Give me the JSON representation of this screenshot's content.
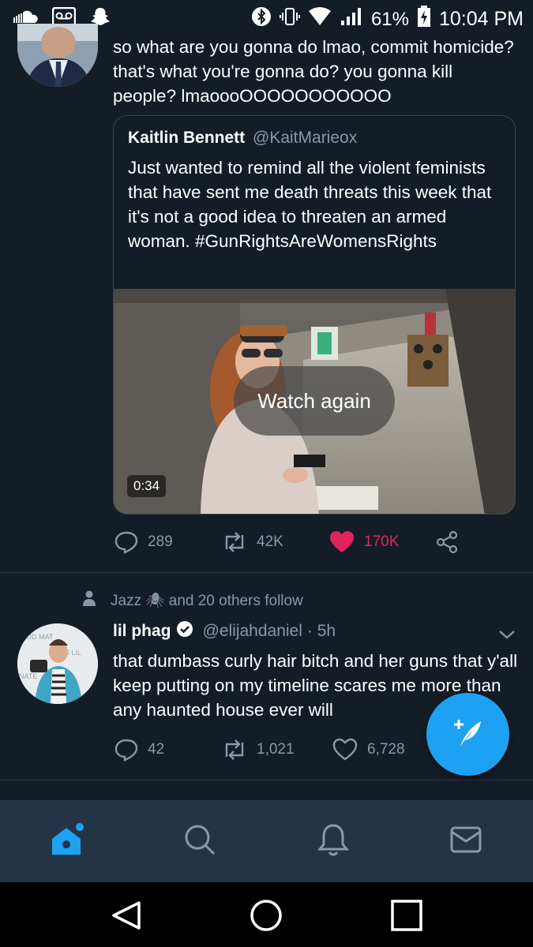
{
  "status_bar": {
    "battery": "61%",
    "time": "10:04 PM",
    "left_icons": [
      "soundcloud-icon",
      "voicemail-icon",
      "snapchat-icon"
    ],
    "right_icons": [
      "bluetooth-icon",
      "vibrate-icon",
      "wifi-icon",
      "signal-icon",
      "battery-charging-icon"
    ]
  },
  "tweet1": {
    "text": "so what are you gonna do lmao, commit homicide? that's what you're gonna do? you gonna kill people? lmaoooOOOOOOOOOOO",
    "quote": {
      "name": "Kaitlin Bennett",
      "handle": "@KaitMarieox",
      "text": "Just wanted to remind all the violent feminists that have sent me death threats this week that it's not a good idea to threaten an armed woman. #GunRightsAreWomensRights",
      "video": {
        "overlay": "Watch again",
        "duration": "0:34"
      }
    },
    "actions": {
      "replies": "289",
      "retweets": "42K",
      "likes": "170K"
    },
    "liked": true
  },
  "tweet2": {
    "social_context": "Jazz 🕷 and 20 others follow",
    "name": "lil phag",
    "handle": "@elijahdaniel",
    "time": "· 5h",
    "text": "that dumbass curly hair bitch and her guns that y'all keep putting on my timeline scares me more than any haunted house ever will",
    "actions": {
      "replies": "42",
      "retweets": "1,021",
      "likes": "6,728"
    }
  },
  "nav": [
    "home-icon",
    "search-icon",
    "notifications-icon",
    "messages-icon"
  ],
  "system_nav": [
    "back-button",
    "home-button",
    "recents-button"
  ],
  "colors": {
    "background": "#141d26",
    "accent": "#1da1f2",
    "like": "#e0245e",
    "muted": "#8899a6",
    "tabbar": "#243447"
  }
}
